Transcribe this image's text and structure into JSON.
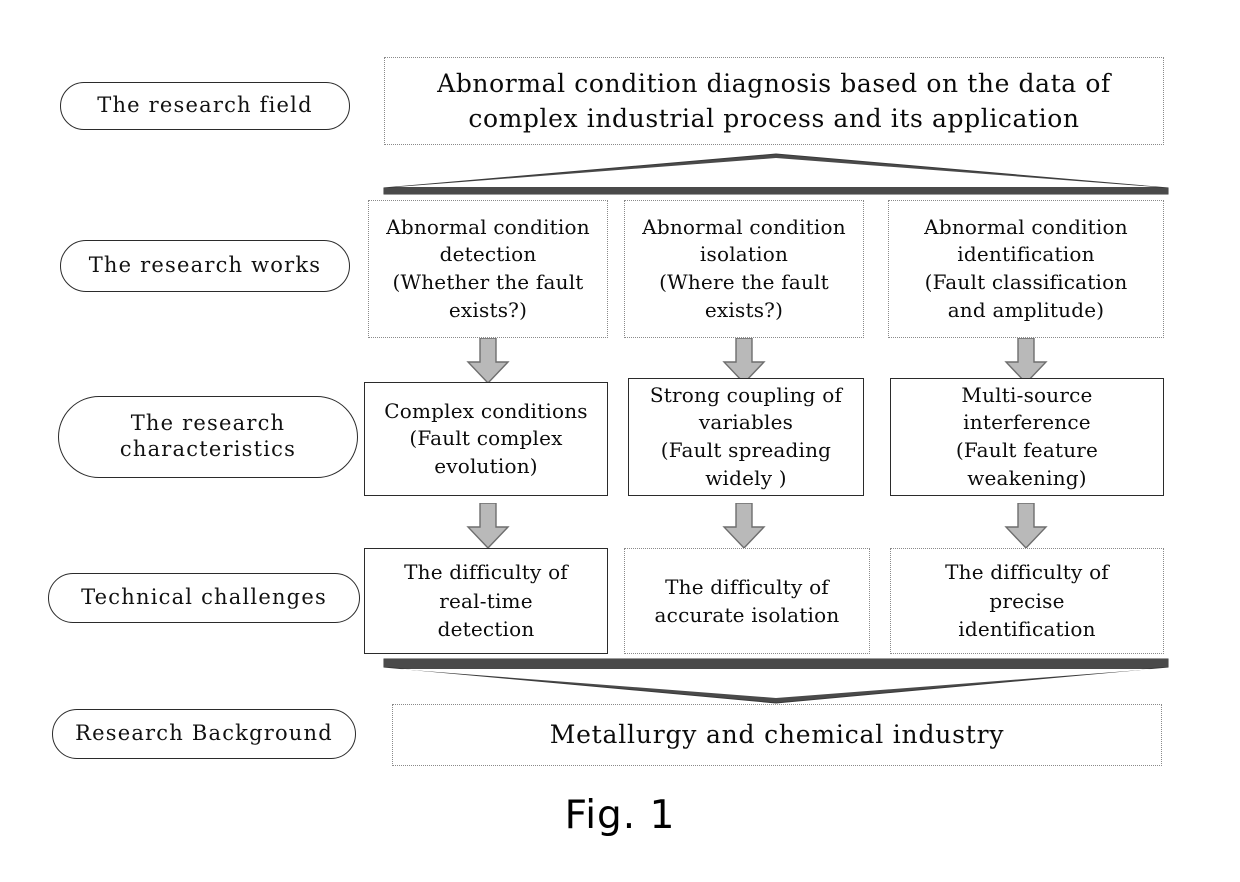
{
  "figure": {
    "caption": "Fig. 1"
  },
  "stages": [
    {
      "id": "research-field",
      "label": "The research field"
    },
    {
      "id": "research-works",
      "label": "The research works"
    },
    {
      "id": "research-characteristics",
      "label": "The research\ncharacteristics"
    },
    {
      "id": "technical-challenges",
      "label": "Technical challenges"
    },
    {
      "id": "research-background",
      "label": "Research Background"
    }
  ],
  "title_node": {
    "text": "Abnormal condition diagnosis based on the data of\ncomplex industrial process  and its application"
  },
  "works": [
    {
      "id": "abnormal-condition-detection",
      "text": "Abnormal condition\ndetection\n(Whether the fault\nexists?)"
    },
    {
      "id": "abnormal-condition-isolation",
      "text": "Abnormal condition\nisolation\n(Where the fault\nexists?)"
    },
    {
      "id": "abnormal-condition-identification",
      "text": "Abnormal condition\nidentification\n(Fault classification\nand amplitude)"
    }
  ],
  "characteristics": [
    {
      "id": "complex-conditions",
      "text": "Complex conditions\n(Fault complex\nevolution)"
    },
    {
      "id": "strong-coupling-variables",
      "text": "Strong coupling of\nvariables\n(Fault spreading\nwidely )"
    },
    {
      "id": "multi-source-interference",
      "text": "Multi-source\ninterference\n(Fault feature\nweakening)"
    }
  ],
  "challenges": [
    {
      "id": "difficulty-real-time-detection",
      "text": "The difficulty of\nreal-time\ndetection"
    },
    {
      "id": "difficulty-accurate-isolation",
      "text": "The difficulty of\naccurate isolation"
    },
    {
      "id": "difficulty-precise-identification",
      "text": "The difficulty of\nprecise\nidentification"
    }
  ],
  "background_node": {
    "text": "Metallurgy and chemical industry"
  },
  "colors": {
    "arrow_fill": "#b9b9b9",
    "arrow_stroke": "#6e6e6e",
    "connector_fill": "#4a4a4a",
    "box_solid_border": "#2b2b2b",
    "box_dotted_border": "#8a8a8a",
    "text": "#0b0b0b"
  }
}
